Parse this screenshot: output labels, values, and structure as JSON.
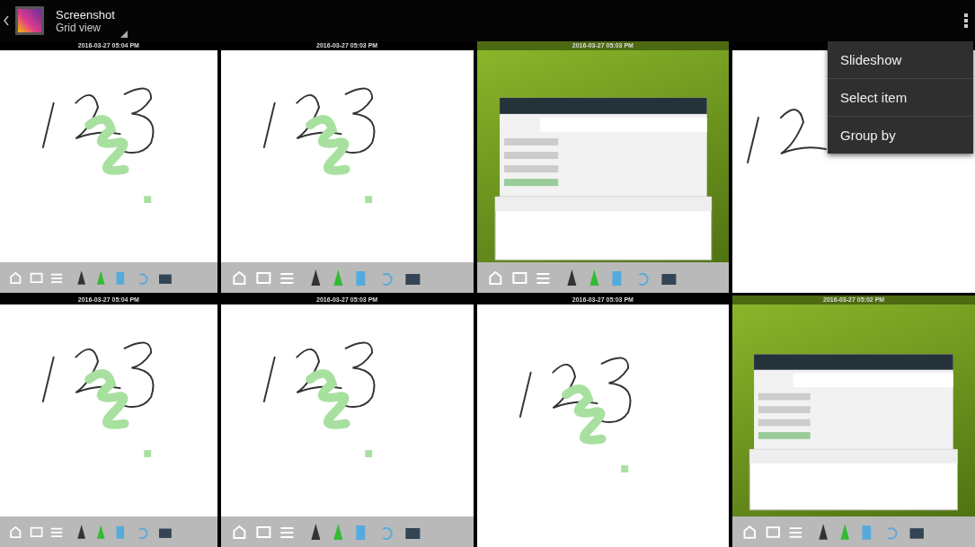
{
  "action_bar": {
    "title": "Screenshot",
    "subtitle": "Grid view"
  },
  "grid": [
    {
      "timestamp": "2016-03-27 05:04 PM",
      "kind": "whiteboard",
      "toolbar": true
    },
    {
      "timestamp": "2016-03-27 05:03 PM",
      "kind": "whiteboard",
      "toolbar": true
    },
    {
      "timestamp": "2016-03-27 05:03 PM",
      "kind": "settings",
      "toolbar": true
    },
    {
      "kind": "whiteboard_covered",
      "toolbar": false
    },
    {
      "timestamp": "2016-03-27 05:04 PM",
      "kind": "whiteboard",
      "toolbar": true
    },
    {
      "timestamp": "2016-03-27 05:03 PM",
      "kind": "whiteboard",
      "toolbar": true
    },
    {
      "timestamp": "2016-03-27 05:03 PM",
      "kind": "whiteboard",
      "toolbar": false
    },
    {
      "timestamp": "2016-03-27 05:02 PM",
      "kind": "settings",
      "toolbar": true
    }
  ],
  "menu": {
    "items": [
      "Slideshow",
      "Select item",
      "Group by"
    ]
  }
}
